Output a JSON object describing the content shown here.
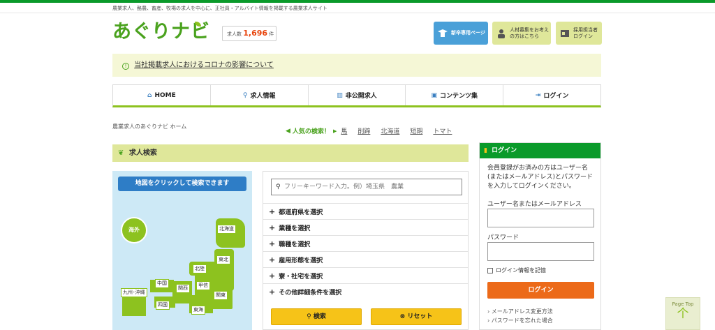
{
  "header": {
    "tagline": "農業求人、酪農、畜産、牧場の求人を中心に、正社員・アルバイト情報を掲載する農業求人サイト",
    "logo_text": "あぐりナビ",
    "count_label": "求人数",
    "count_value": "1,696",
    "count_unit": "件",
    "buttons": {
      "new_grad": "新卒専用ページ",
      "corp_line1": "人材募集をお考え",
      "corp_line2": "の方はこちら",
      "recruiter_line1": "採用担当者",
      "recruiter_line2": "ログイン"
    }
  },
  "notice": {
    "text": "当社掲載求人におけるコロナの影響について"
  },
  "nav": {
    "items": [
      {
        "label": "HOME",
        "icon": "home-icon"
      },
      {
        "label": "求人情報",
        "icon": "search-icon"
      },
      {
        "label": "非公開求人",
        "icon": "building-icon"
      },
      {
        "label": "コンテンツ集",
        "icon": "book-icon"
      },
      {
        "label": "ログイン",
        "icon": "login-icon"
      }
    ]
  },
  "breadcrumb": "農業求人のあぐりナビ ホーム",
  "popular": {
    "label": "人気の検索！",
    "keywords": [
      "馬",
      "削蹄",
      "北海道",
      "短期",
      "トマト"
    ]
  },
  "search_section": {
    "title": "求人検索",
    "map_button": "地図をクリックして検索できます",
    "map_regions": {
      "overseas": "海外",
      "hokkaido": "北海道",
      "tohoku": "東北",
      "hokuriku": "北陸",
      "koshinetsu": "甲信",
      "kanto": "関東",
      "tokai": "東海",
      "kansai": "関西",
      "chugoku": "中国",
      "shikoku": "四国",
      "kyushu": "九州･沖縄"
    },
    "keyword_placeholder": "フリーキーワード入力。例）埼玉県　農業",
    "filters": [
      "都道府県を選択",
      "業種を選択",
      "職種を選択",
      "雇用形態を選択",
      "寮・社宅を選択",
      "その他詳細条件を選択"
    ],
    "search_button": "検索",
    "reset_button": "リセット"
  },
  "login": {
    "title": "ログイン",
    "description": "会員登録がお済みの方はユーザー名(またはメールアドレス)とパスワードを入力してログインください。",
    "username_label": "ユーザー名またはメールアドレス",
    "password_label": "パスワード",
    "remember_label": "ログイン情報を記憶",
    "login_button": "ログイン",
    "link_change_email": "メールアドレス変更方法",
    "link_forgot_password": "パスワードを忘れた場合"
  },
  "pagetop": {
    "label": "Page Top",
    "arrow": "个"
  },
  "colors": {
    "brand_green": "#0a9a2a",
    "leaf_green": "#8dc21f",
    "light_olive": "#dfe79a",
    "map_blue": "#cde9f6",
    "button_yellow": "#f6c318",
    "login_orange": "#ec6a19",
    "accent_red": "#e8440c"
  }
}
